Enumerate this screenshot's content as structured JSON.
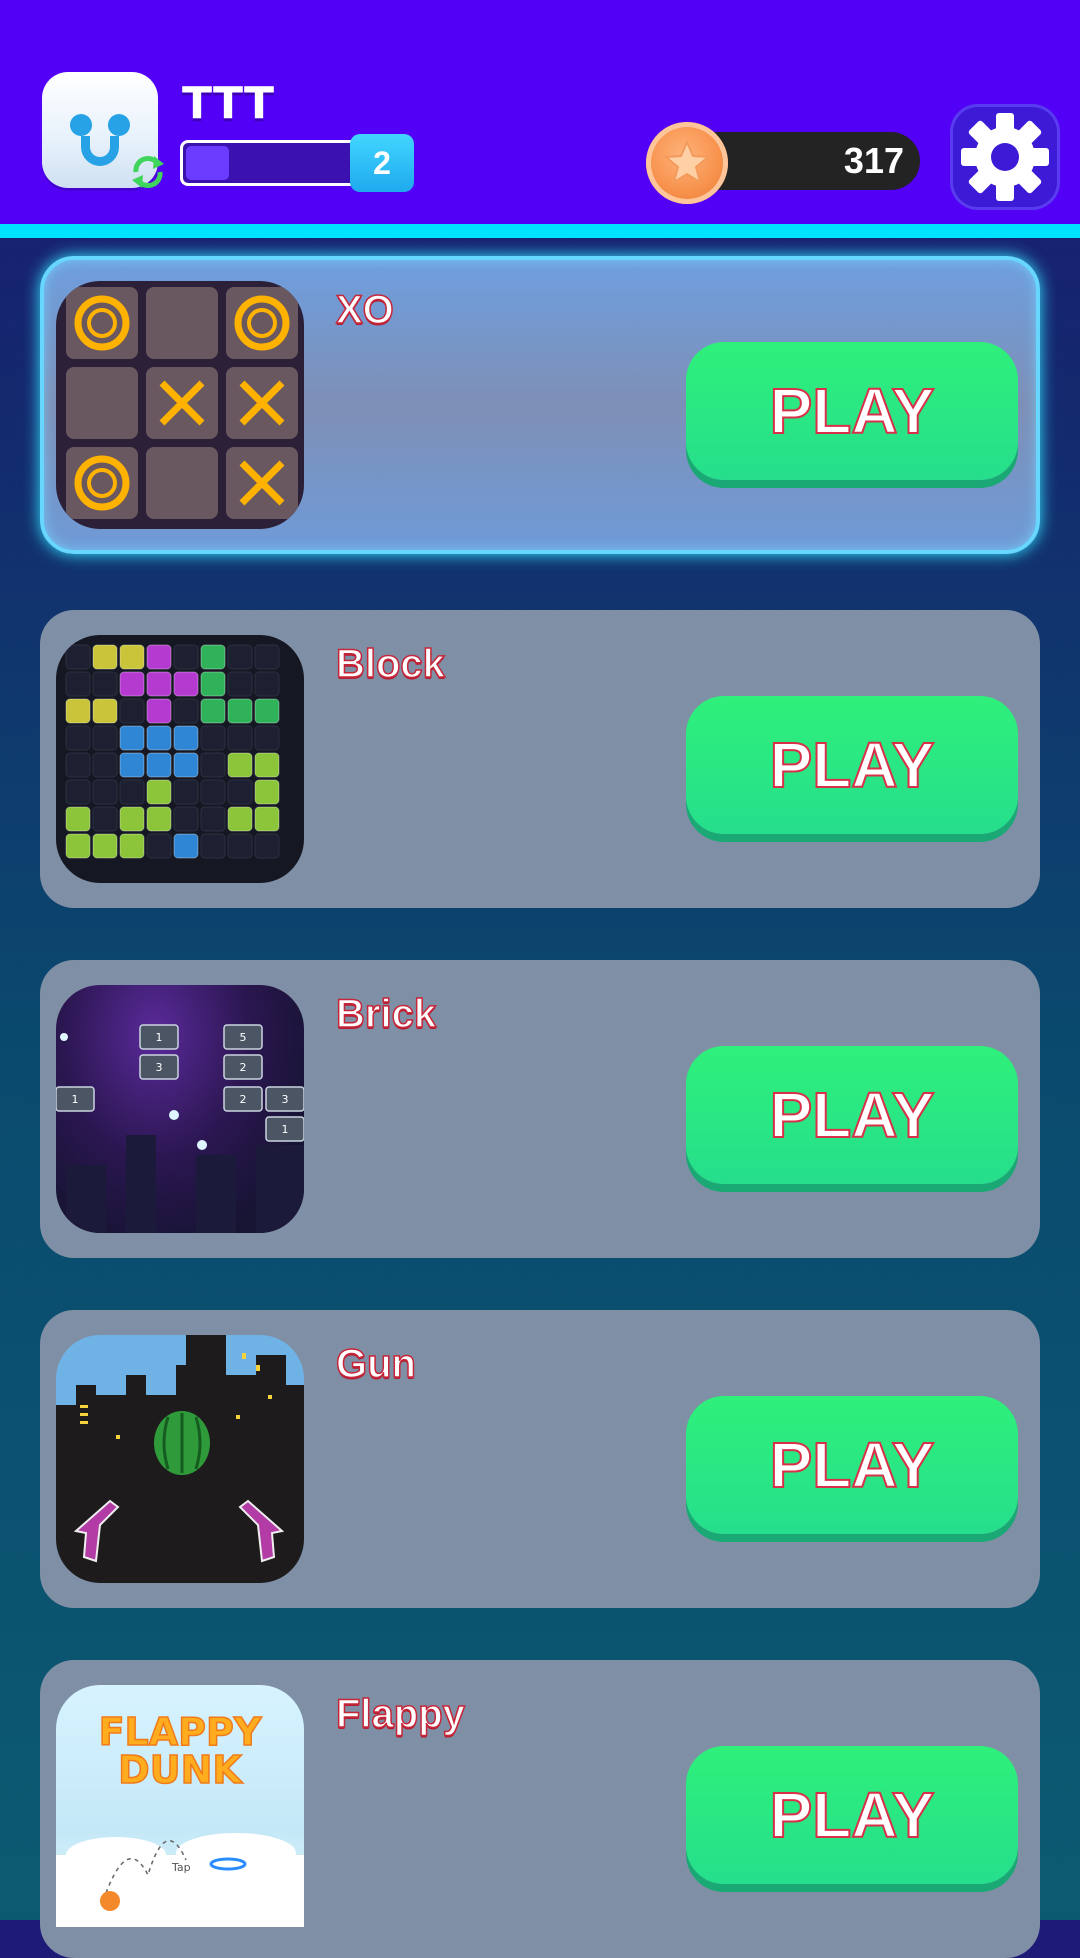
{
  "header": {
    "username": "TTT",
    "level": "2",
    "level_progress": 0.25,
    "coins": "317",
    "avatar_icon": "smiley-face-avatar",
    "sync_icon": "refresh-arrows-icon",
    "coin_icon": "star-coin-icon",
    "settings_icon": "gear-icon"
  },
  "colors": {
    "header_bg": "#5300f7",
    "accent_line": "#00e4ff",
    "play_button": "#2ef07a",
    "title_outline": "#c7263a",
    "card_bg": "#7f8fa5",
    "card_selected_border": "#68d7ff"
  },
  "games": [
    {
      "title": "XO",
      "button": "PLAY",
      "selected": true,
      "thumbnail": "tic-tac-toe-neon"
    },
    {
      "title": "Block",
      "button": "PLAY",
      "selected": false,
      "thumbnail": "block-puzzle-neon"
    },
    {
      "title": "Brick",
      "button": "PLAY",
      "selected": false,
      "thumbnail": "brick-breaker-space"
    },
    {
      "title": "Gun",
      "button": "PLAY",
      "selected": false,
      "thumbnail": "watermelon-guns-city"
    },
    {
      "title": "Flappy",
      "button": "PLAY",
      "selected": false,
      "thumbnail": "flappy-dunk",
      "thumbnail_text": {
        "line1": "FLAPPY",
        "line2": "DUNK",
        "hint": "Tap"
      }
    }
  ]
}
